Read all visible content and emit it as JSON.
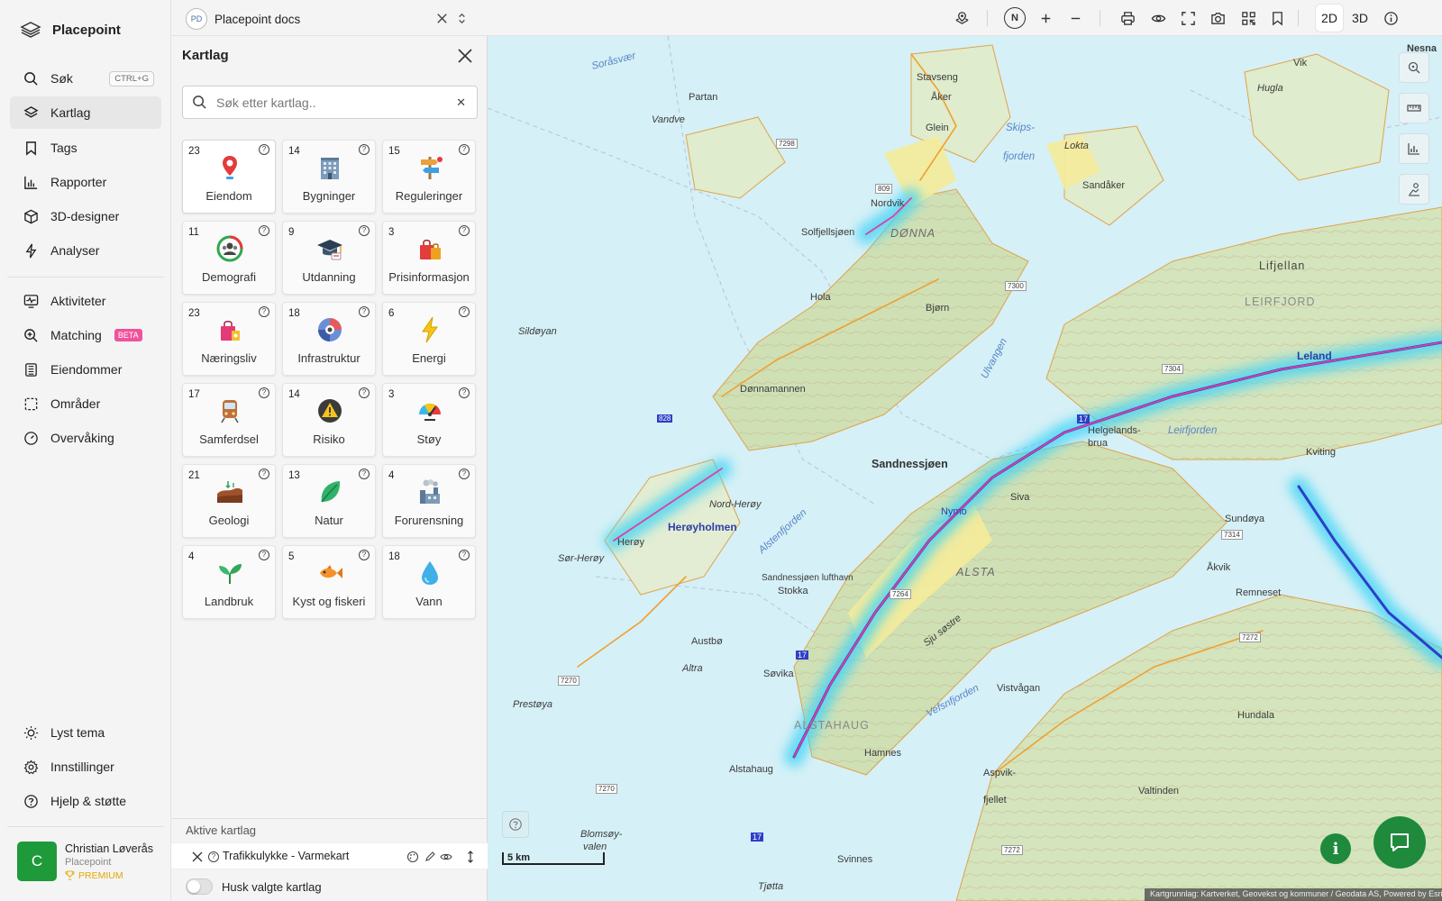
{
  "brand": {
    "name": "Placepoint"
  },
  "nav": {
    "items": [
      {
        "label": "Søk",
        "icon": "search-icon",
        "shortcut": "CTRL+G"
      },
      {
        "label": "Kartlag",
        "icon": "layers-icon"
      },
      {
        "label": "Tags",
        "icon": "bookmark-icon"
      },
      {
        "label": "Rapporter",
        "icon": "bar-chart-icon"
      },
      {
        "label": "3D-designer",
        "icon": "cube-icon"
      },
      {
        "label": "Analyser",
        "icon": "lightning-icon"
      },
      {
        "label": "Aktiviteter",
        "icon": "activity-monitor-icon"
      },
      {
        "label": "Matching",
        "icon": "magnifier-plus-icon",
        "badge": "BETA"
      },
      {
        "label": "Eiendommer",
        "icon": "building-icon"
      },
      {
        "label": "Områder",
        "icon": "dashed-square-icon"
      },
      {
        "label": "Overvåking",
        "icon": "gauge-icon"
      }
    ],
    "bottom": [
      {
        "label": "Lyst tema",
        "icon": "sun-icon"
      },
      {
        "label": "Innstillinger",
        "icon": "gear-icon"
      },
      {
        "label": "Hjelp & støtte",
        "icon": "help-circle-icon"
      }
    ]
  },
  "user": {
    "initial": "C",
    "name": "Christian Løverås",
    "org": "Placepoint",
    "plan": "PREMIUM"
  },
  "topbar": {
    "workspace_badge": "PD",
    "workspace_name": "Placepoint docs",
    "compass": "N",
    "dim_2d": "2D",
    "dim_3d": "3D"
  },
  "panel": {
    "title": "Kartlag",
    "search_placeholder": "Søk etter kartlag..",
    "categories": [
      {
        "count": "23",
        "label": "Eiendom",
        "icon": "map-pin-icon"
      },
      {
        "count": "14",
        "label": "Bygninger",
        "icon": "office-building-icon"
      },
      {
        "count": "15",
        "label": "Reguleringer",
        "icon": "signpost-icon"
      },
      {
        "count": "11",
        "label": "Demografi",
        "icon": "people-ring-icon"
      },
      {
        "count": "9",
        "label": "Utdanning",
        "icon": "graduation-cap-icon"
      },
      {
        "count": "3",
        "label": "Prisinformasjon",
        "icon": "shopping-bags-icon"
      },
      {
        "count": "23",
        "label": "Næringsliv",
        "icon": "shopping-bag-icon"
      },
      {
        "count": "18",
        "label": "Infrastruktur",
        "icon": "infrastructure-icon"
      },
      {
        "count": "6",
        "label": "Energi",
        "icon": "lightning-bolt-icon"
      },
      {
        "count": "17",
        "label": "Samferdsel",
        "icon": "train-icon"
      },
      {
        "count": "14",
        "label": "Risiko",
        "icon": "warning-icon"
      },
      {
        "count": "3",
        "label": "Støy",
        "icon": "noise-gauge-icon"
      },
      {
        "count": "21",
        "label": "Geologi",
        "icon": "soil-layers-icon"
      },
      {
        "count": "13",
        "label": "Natur",
        "icon": "leaf-icon"
      },
      {
        "count": "4",
        "label": "Forurensning",
        "icon": "factory-icon"
      },
      {
        "count": "4",
        "label": "Landbruk",
        "icon": "sprout-icon"
      },
      {
        "count": "5",
        "label": "Kyst og fiskeri",
        "icon": "fish-icon"
      },
      {
        "count": "18",
        "label": "Vann",
        "icon": "water-drop-icon"
      }
    ],
    "active_title": "Aktive kartlag",
    "active_layer": "Trafikkulykke - Varmekart",
    "remember_label": "Husk valgte kartlag"
  },
  "map": {
    "labels": {
      "soraasvaer": "Soråsvær",
      "nesna": "Nesna",
      "vik": "Vik",
      "hugla": "Hugla",
      "stavseng": "Stavseng",
      "aker": "Åker",
      "partan": "Partan",
      "vandve": "Vandve",
      "glein": "Glein",
      "skipsfjorden_1": "Skips-",
      "skipsfjorden_2": "fjorden",
      "lokta": "Lokta",
      "sandaker": "Sandåker",
      "nordvik": "Nordvik",
      "solfjellsjoen": "Solfjellsjøen",
      "donna": "DØNNA",
      "liljellan": "Lifjellan",
      "leirfjord": "LEIRFJORD",
      "hola": "Hola",
      "bjorn": "Bjørn",
      "sildoyan": "Sildøyan",
      "ulvangen": "Ulvangen",
      "leland": "Leland",
      "donnamannen": "Dønnamannen",
      "helgelandsbrua_1": "Helgelands-",
      "helgelandsbrua_2": "brua",
      "leirfjorden": "Leirfjorden",
      "sandnessjoen": "Sandnessjøen",
      "kviting": "Kviting",
      "nord_heroy": "Nord-Herøy",
      "siva": "Siva",
      "nymo": "Nymo",
      "heroyholmen": "Herøyholmen",
      "sundoya": "Sundøya",
      "sor_heroy": "Sør-Herøy",
      "heroy": "Herøy",
      "alstenfjorden": "Alstenfjorden",
      "akvik": "Åkvik",
      "sandnessjoen_lufthavn": "Sandnessjøen lufthavn",
      "stokka": "Stokka",
      "alsta": "ALSTA",
      "remneset": "Remneset",
      "syv_sostre": "Sju søstre",
      "austbo": "Austbø",
      "altra": "Altra",
      "sovika": "Søvika",
      "prestoya": "Prestøya",
      "vistvagan": "Vistvågan",
      "alstahaug_muni": "ALSTAHAUG",
      "vefsnfjorden": "Vefsnfjorden",
      "hundala": "Hundala",
      "hamnes": "Hamnes",
      "alstahaug": "Alstahaug",
      "aspvikfjellet_1": "Aspvik-",
      "aspvikfjellet_2": "fjellet",
      "valtinden": "Valtinden",
      "blomsoyvalen_1": "Blomsøy-",
      "blomsoyvalen_2": "valen",
      "svinnes": "Svinnes",
      "tjotta": "Tjøtta",
      "r7298": "7298",
      "r809": "809",
      "r7300": "7300",
      "r7304": "7304",
      "r828": "828",
      "r17a": "17",
      "r7314": "7314",
      "r7264": "7264",
      "r7272a": "7272",
      "r7270a": "7270",
      "r17b": "17",
      "r7270b": "7270",
      "r17c": "17",
      "r7272b": "7272"
    },
    "scale": "5 km",
    "attribution": "Kartgrunnlag: Kartverket, Geovekst og kommuner / Geodata AS, Powered by Esri"
  }
}
